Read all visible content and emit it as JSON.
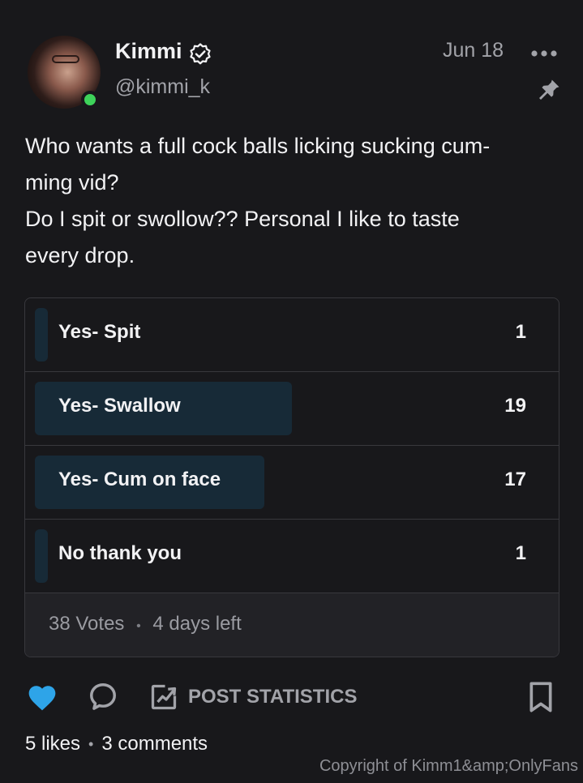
{
  "post": {
    "author_name": "Kimmi",
    "author_handle": "@kimmi_k",
    "date": "Jun 18",
    "text_lines": [
      "Who wants a full cock balls licking sucking cum-",
      "ming vid?",
      "Do I spit or swollow?? Personal I like to taste",
      "every drop."
    ],
    "icons": [
      "verified-icon",
      "more-options-icon",
      "pin-icon",
      "heart-icon",
      "comment-icon",
      "post-statistics-icon",
      "bookmark-icon"
    ]
  },
  "poll": {
    "options": [
      {
        "label": "Yes- Spit",
        "count": "1",
        "share": 0.026
      },
      {
        "label": "Yes- Swallow",
        "count": "19",
        "share": 0.5
      },
      {
        "label": "Yes- Cum on face",
        "count": "17",
        "share": 0.447
      },
      {
        "label": "No thank you",
        "count": "1",
        "share": 0.026
      }
    ],
    "votes": "38 Votes",
    "time_left": "4 days left"
  },
  "actions": {
    "post_statistics_label": "POST STATISTICS"
  },
  "meta": {
    "likes": "5 likes",
    "comments": "3 comments"
  },
  "watermark": "Copyright of Kimm1&amp;OnlyFans",
  "colors": {
    "background": "#18181b",
    "heart": "#2ea4e8",
    "poll_bar": "#172a37",
    "online": "#3ed35a"
  }
}
